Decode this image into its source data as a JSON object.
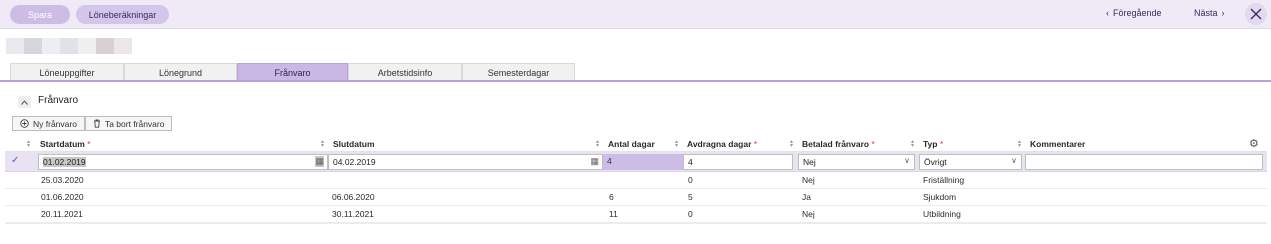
{
  "toolbar": {
    "save_label": "Spara",
    "calc_label": "Löneberäkningar",
    "prev_label": "Föregående",
    "next_label": "Nästa"
  },
  "colors": {
    "accent": "#cdbde5",
    "topbar": "#efeaf6",
    "required": "#d23b3b"
  },
  "tabs": [
    {
      "label": "Löneuppgifter"
    },
    {
      "label": "Lönegrund"
    },
    {
      "label": "Frånvaro"
    },
    {
      "label": "Arbetstidsinfo"
    },
    {
      "label": "Semesterdagar"
    }
  ],
  "section": {
    "title": "Frånvaro",
    "add_label": "Ny frånvaro",
    "remove_label": "Ta bort frånvaro"
  },
  "grid": {
    "columns": [
      {
        "label": "Startdatum",
        "required": "*"
      },
      {
        "label": "Slutdatum",
        "required": ""
      },
      {
        "label": "Antal dagar",
        "required": ""
      },
      {
        "label": "Avdragna dagar",
        "required": "*"
      },
      {
        "label": "Betalad frånvaro",
        "required": "*"
      },
      {
        "label": "Typ",
        "required": "*"
      },
      {
        "label": "Kommentarer",
        "required": ""
      }
    ],
    "edit_row": {
      "start": "01.02.2019",
      "end": "04.02.2019",
      "days": "4",
      "deducted": "4",
      "paid": "Nej",
      "type": "Övrigt",
      "comment": ""
    },
    "rows": [
      {
        "start": "25.03.2020",
        "end": "",
        "days": "",
        "deducted": "0",
        "paid": "Nej",
        "type": "Friställning",
        "comment": ""
      },
      {
        "start": "01.06.2020",
        "end": "06.06.2020",
        "days": "6",
        "deducted": "5",
        "paid": "Ja",
        "type": "Sjukdom",
        "comment": ""
      },
      {
        "start": "20.11.2021",
        "end": "30.11.2021",
        "days": "11",
        "deducted": "0",
        "paid": "Nej",
        "type": "Utbildning",
        "comment": ""
      }
    ]
  }
}
